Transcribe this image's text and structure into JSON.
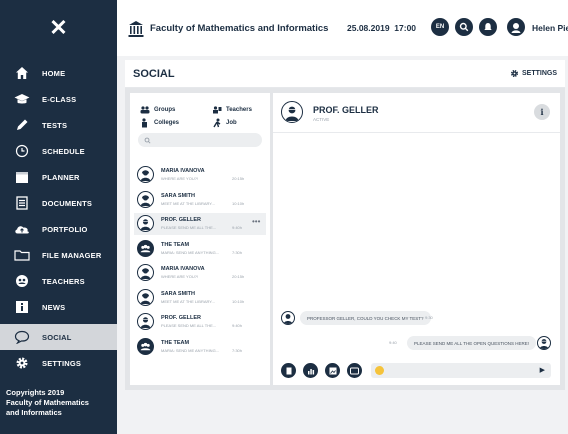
{
  "sidebar": {
    "close_icon": "close-icon",
    "items": [
      {
        "label": "HOME",
        "icon": "home-icon"
      },
      {
        "label": "E-CLASS",
        "icon": "graduation-cap-icon"
      },
      {
        "label": "TESTS",
        "icon": "pencil-icon"
      },
      {
        "label": "SCHEDULE",
        "icon": "clock-icon"
      },
      {
        "label": "PLANNER",
        "icon": "calendar-icon"
      },
      {
        "label": "DOCUMENTS",
        "icon": "documents-icon"
      },
      {
        "label": "PORTFOLIO",
        "icon": "cloud-upload-icon"
      },
      {
        "label": "FILE MANAGER",
        "icon": "folder-icon"
      },
      {
        "label": "TEACHERS",
        "icon": "teachers-icon"
      },
      {
        "label": "NEWS",
        "icon": "info-icon"
      },
      {
        "label": "SOCIAL",
        "icon": "chat-bubble-icon"
      },
      {
        "label": "SETTINGS",
        "icon": "gear-icon"
      }
    ],
    "active_label": "SOCIAL",
    "footer": [
      "Copyrights 2019",
      "Faculty of Mathematics",
      "and Informatics"
    ]
  },
  "header": {
    "title": "Faculty of Mathematics and Informatics",
    "date": "25.08.2019",
    "time": "17:00",
    "buttons": [
      "en-language-icon",
      "search-icon",
      "bell-icon",
      "user-avatar-icon"
    ],
    "lang_label": "EN",
    "user_name": "Helen Pierce"
  },
  "page": {
    "title": "SOCIAL",
    "settings_label": "SETTINGS"
  },
  "filters": [
    {
      "label": "Groups",
      "icon": "groups-icon"
    },
    {
      "label": "Teachers",
      "icon": "teacher-icon"
    },
    {
      "label": "Colleges",
      "icon": "colleges-icon"
    },
    {
      "label": "Job",
      "icon": "job-icon"
    }
  ],
  "search": {
    "placeholder": ""
  },
  "contacts": [
    {
      "name": "MARIA IVANOVA",
      "message": "Where are you?!",
      "time": "20:15h",
      "avatar": "female-avatar-icon",
      "dark": false
    },
    {
      "name": "SARA SMITH",
      "message": "Meet me at the library...",
      "time": "10:10h",
      "avatar": "female-avatar-icon",
      "dark": false
    },
    {
      "name": "PROF. GELLER",
      "message": "Please send me all the...",
      "time": "9:40h",
      "avatar": "professor-avatar-icon",
      "dark": false,
      "selected": true,
      "more": "•••"
    },
    {
      "name": "THE TEAM",
      "message": "Maria: Send me anything...",
      "time": "7:30h",
      "avatar": "team-avatar-icon",
      "dark": true
    },
    {
      "name": "MARIA IVANOVA",
      "message": "Where are you?!",
      "time": "20:15h",
      "avatar": "female-avatar-icon",
      "dark": false
    },
    {
      "name": "SARA SMITH",
      "message": "Meet me at the library...",
      "time": "10:10h",
      "avatar": "female-avatar-icon",
      "dark": false
    },
    {
      "name": "PROF. GELLER",
      "message": "Please send me all the...",
      "time": "9:40h",
      "avatar": "professor-avatar-icon",
      "dark": false
    },
    {
      "name": "THE TEAM",
      "message": "Maria: Send me anything...",
      "time": "7:30h",
      "avatar": "team-avatar-icon",
      "dark": true
    }
  ],
  "chat": {
    "name": "PROF. GELLER",
    "status": "ACTIVE",
    "info_label": "i",
    "messages": [
      {
        "from": "user",
        "text": "Professor Geller, could you check my test?",
        "time": "9:30"
      },
      {
        "from": "professor",
        "text": "Please send me all the open questions here!",
        "time": "9:40"
      }
    ],
    "composer": {
      "buttons": [
        "document-icon",
        "chart-icon",
        "image-icon",
        "media-icon"
      ],
      "emoji": "emoji-icon",
      "send": "send-icon"
    }
  },
  "colors": {
    "navy": "#1c2e42",
    "active_bg": "#d3d6da",
    "emoji": "#f5c33b"
  }
}
